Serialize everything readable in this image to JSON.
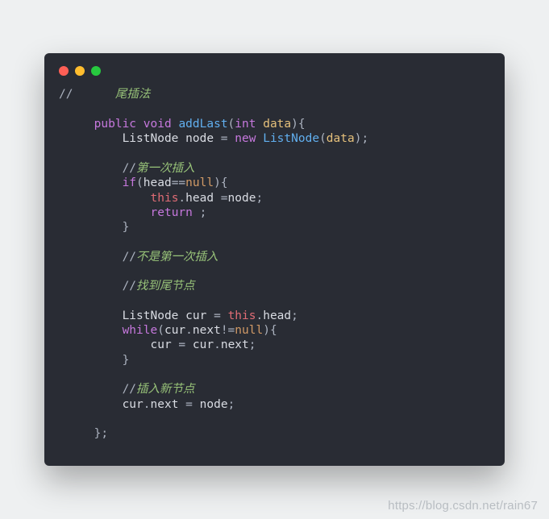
{
  "watermark": "https://blog.csdn.net/rain67",
  "tokens": {
    "t0": "//      ",
    "t1": "尾插法",
    "t2": "public",
    "t3": "void",
    "t4": "addLast",
    "t5": "int",
    "t6": "data",
    "t7": "ListNode",
    "t8": "node",
    "t9": "new",
    "t10": "ListNode",
    "t11": "//",
    "t12": "第一次插入",
    "t13": "if",
    "t14": "head",
    "t15": "null",
    "t16": "this",
    "t17": "head",
    "t18": "return",
    "t19": "不是第一次插入",
    "t20": "找到尾节点",
    "t21": "cur",
    "t22": "while",
    "t23": "next",
    "t24": "插入新节点",
    "t25": "};"
  }
}
